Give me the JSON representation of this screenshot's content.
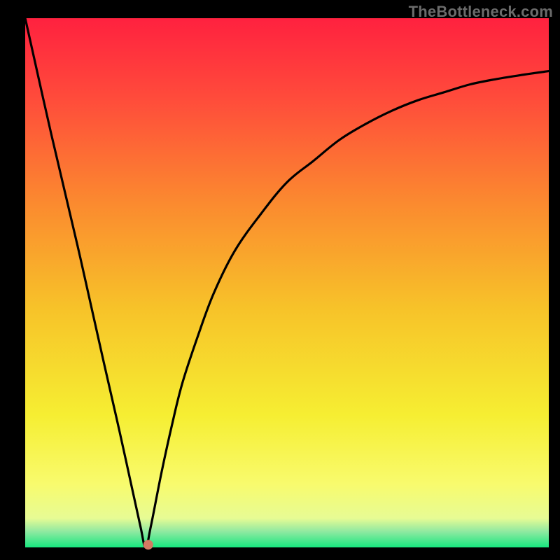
{
  "watermark": "TheBottleneck.com",
  "chart_data": {
    "type": "line",
    "title": "",
    "xlabel": "",
    "ylabel": "",
    "xlim": [
      0,
      100
    ],
    "ylim": [
      0,
      100
    ],
    "grid": false,
    "background_gradient": {
      "stops": [
        {
          "offset": 0.0,
          "color": "#ff213f"
        },
        {
          "offset": 0.15,
          "color": "#ff4b3b"
        },
        {
          "offset": 0.35,
          "color": "#fb8a2f"
        },
        {
          "offset": 0.55,
          "color": "#f7c329"
        },
        {
          "offset": 0.75,
          "color": "#f6ee32"
        },
        {
          "offset": 0.88,
          "color": "#f8fb6d"
        },
        {
          "offset": 0.945,
          "color": "#e7fb94"
        },
        {
          "offset": 0.97,
          "color": "#8fe9a1"
        },
        {
          "offset": 1.0,
          "color": "#17e87f"
        }
      ]
    },
    "curve": {
      "comment": "Piecewise: linear drop from (0,100) to a notch minimum near x≈23, then an asymptotic rise toward ~90 at x=100.",
      "x": [
        0,
        5,
        10,
        15,
        18,
        20,
        22,
        23,
        24,
        26,
        28,
        30,
        33,
        36,
        40,
        45,
        50,
        55,
        60,
        65,
        70,
        75,
        80,
        85,
        90,
        95,
        100
      ],
      "y": [
        100,
        78,
        57,
        35,
        22,
        13,
        4,
        0,
        4,
        14,
        23,
        31,
        40,
        48,
        56,
        63,
        69,
        73,
        77,
        80,
        82.5,
        84.5,
        86,
        87.5,
        88.5,
        89.3,
        90
      ]
    },
    "marker": {
      "comment": "Small salmon dot at the curve minimum.",
      "x": 23.5,
      "y": 0.5,
      "color": "#d47a63",
      "radius_px": 7
    }
  },
  "layout": {
    "outer_size": 800,
    "plot_inset_left": 36,
    "plot_inset_top": 26,
    "plot_inset_right": 16,
    "plot_inset_bottom": 18
  }
}
